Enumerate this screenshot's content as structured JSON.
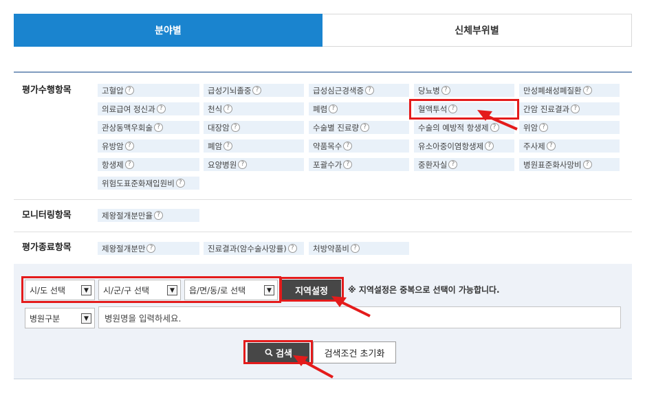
{
  "tabs": {
    "field": "분야별",
    "body_part": "신체부위별"
  },
  "sections": {
    "evaluation": {
      "title": "평가수행항목",
      "rows": [
        [
          "고혈압",
          "급성기뇌졸중",
          "급성심근경색증",
          "당뇨병",
          "만성폐쇄성폐질환"
        ],
        [
          "의료급여 정신과",
          "천식",
          "폐렴",
          "혈액투석",
          "간암 진료결과"
        ],
        [
          "관상동맥우회술",
          "대장암",
          "수술별 진료량",
          "수술의 예방적 항생제",
          "위암"
        ],
        [
          "유방암",
          "폐암",
          "약품목수",
          "유소아중이염항생제",
          "주사제"
        ],
        [
          "항생제",
          "요양병원",
          "포괄수가",
          "중환자실",
          "병원표준화사망비"
        ],
        [
          "위험도표준화재입원비"
        ]
      ]
    },
    "monitoring": {
      "title": "모니터링항목",
      "items": [
        "제왕절개분만율"
      ]
    },
    "ended": {
      "title": "평가종료항목",
      "items": [
        "제왕절개분만",
        "진료결과(암수술사망률)",
        "처방약품비"
      ]
    }
  },
  "help_symbol": "?",
  "search": {
    "sido": "시/도 선택",
    "sigungu": "시/군/구 선택",
    "eupmyeondong": "읍/면/동/로 선택",
    "region_button": "지역설정",
    "note": "※ 지역설정은 중복으로 선택이 가능합니다.",
    "hospital_type": "병원구분",
    "hospital_placeholder": "병원명을 입력하세요.",
    "search_button": "검색",
    "reset_button": "검색조건 초기화",
    "dropdown_arrow": "▼",
    "search_icon": "magnifier-icon"
  },
  "colors": {
    "accent": "#1a84cf",
    "highlight": "#e41b1b",
    "item_bg": "#e9f1f9"
  }
}
